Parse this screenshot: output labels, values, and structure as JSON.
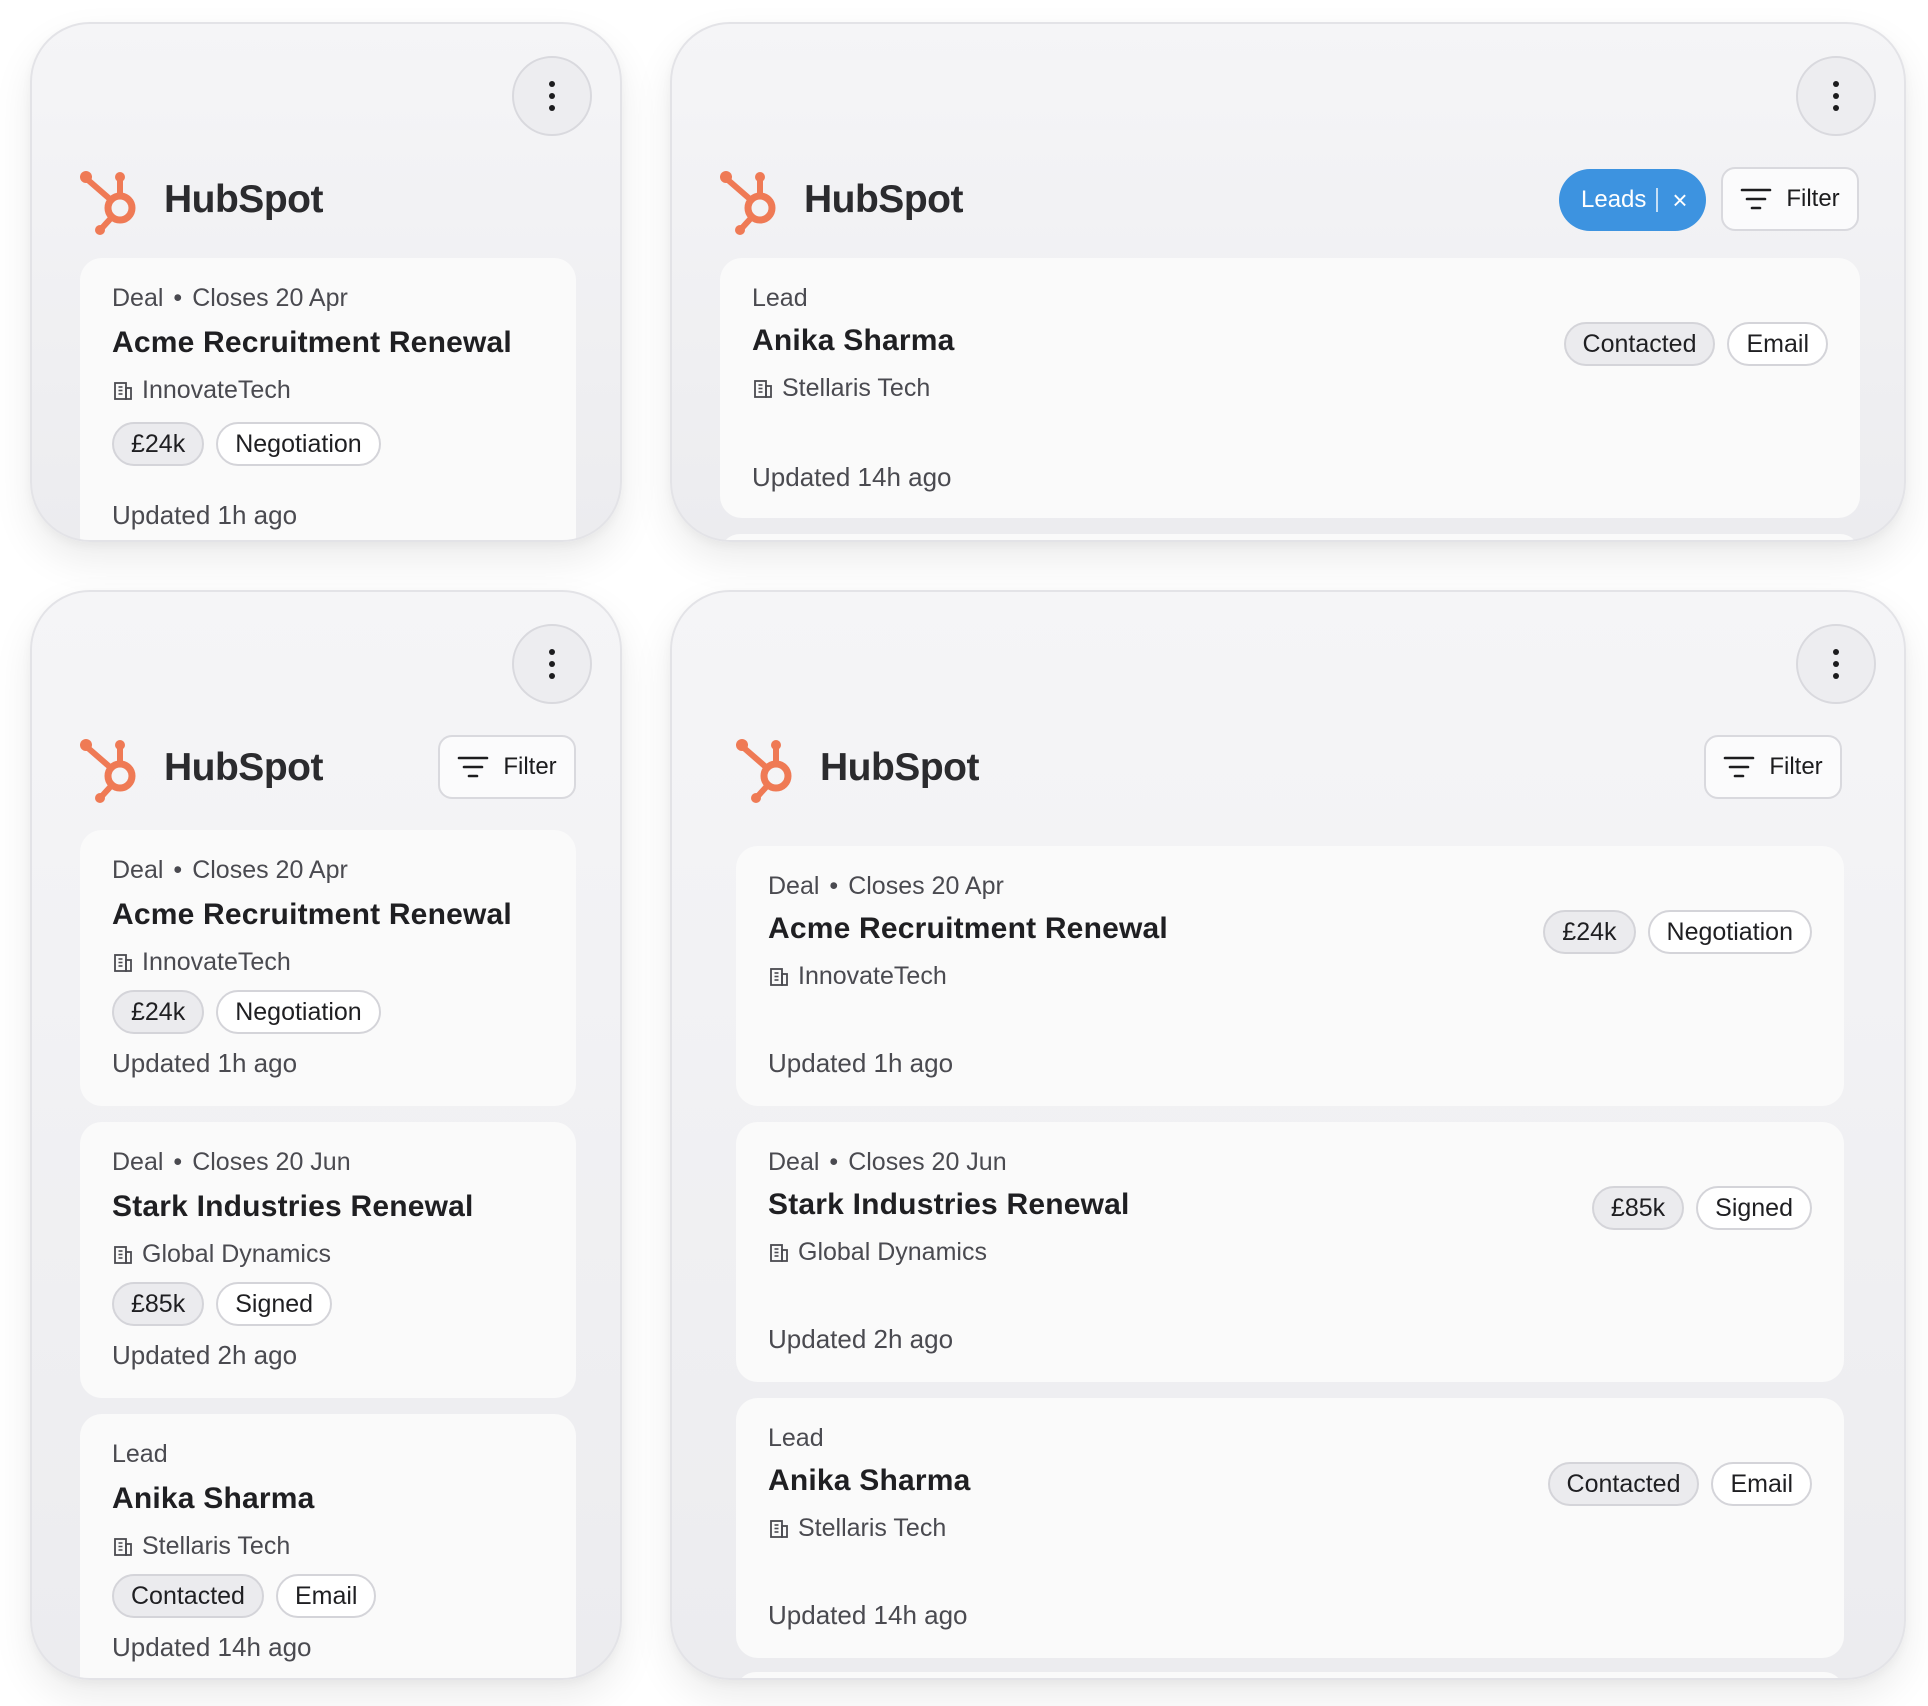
{
  "brand": {
    "name": "HubSpot"
  },
  "controls": {
    "filter_label": "Filter",
    "leads_chip_label": "Leads",
    "leads_chip_close": "×"
  },
  "records": {
    "acme": {
      "kind": "Deal",
      "separator": "•",
      "closes": "Closes 20 Apr",
      "title": "Acme Recruitment Renewal",
      "company": "InnovateTech",
      "amount": "£24k",
      "stage": "Negotiation",
      "updated": "Updated 1h ago"
    },
    "stark": {
      "kind": "Deal",
      "separator": "•",
      "closes": "Closes 20 Jun",
      "title": "Stark Industries Renewal",
      "company": "Global Dynamics",
      "amount": "£85k",
      "stage": "Signed",
      "updated": "Updated 2h ago"
    },
    "anika": {
      "kind": "Lead",
      "title": "Anika Sharma",
      "company": "Stellaris Tech",
      "status": "Contacted",
      "channel": "Email",
      "updated": "Updated 14h ago"
    }
  },
  "icons": {
    "logo": "hubspot-sprocket-icon",
    "menu": "more-vertical-icon",
    "filter": "filter-lines-icon",
    "company": "building-icon",
    "close": "close-icon"
  },
  "colors": {
    "brand_orange": "#ef7a55",
    "chip_blue": "#3d93e0"
  }
}
